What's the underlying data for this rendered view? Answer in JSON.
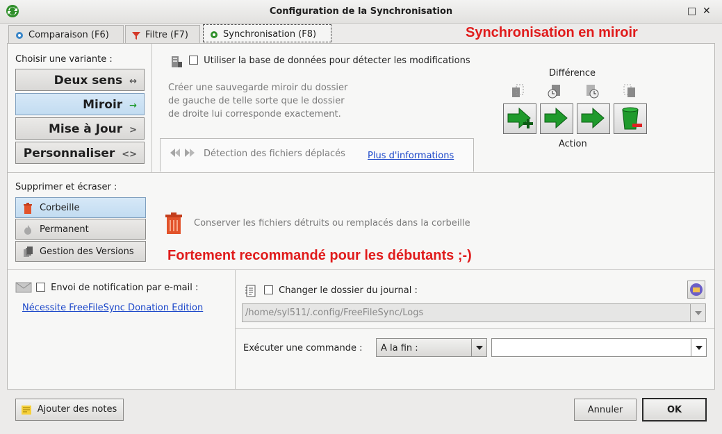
{
  "window": {
    "title": "Configuration de la Synchronisation",
    "maximize_glyph": "□",
    "close_glyph": "✕"
  },
  "tabs": [
    {
      "label": "Comparaison (F6)",
      "icon": "gear-icon"
    },
    {
      "label": "Filtre (F7)",
      "icon": "filter-icon"
    },
    {
      "label": "Synchronisation (F8)",
      "icon": "gear-icon"
    }
  ],
  "annotations": {
    "mirror": "Synchronisation en miroir",
    "recommend": "Fortement recommandé pour les débutants ;-)"
  },
  "variants": {
    "heading": "Choisir une variante :",
    "items": [
      {
        "label": "Deux sens",
        "glyph": "↔"
      },
      {
        "label": "Miroir",
        "glyph": "→"
      },
      {
        "label": "Mise à Jour",
        "glyph": ">"
      },
      {
        "label": "Personnaliser",
        "glyph": "<>"
      }
    ],
    "selected": "Miroir"
  },
  "database": {
    "label": "Utiliser la base de données pour détecter les modifications",
    "checked": false
  },
  "description": "Créer une sauvegarde miroir du dossier de gauche de telle sorte que le dossier de droite lui corresponde exactement.",
  "moved_files": {
    "label": "Détection des fichiers déplacés",
    "link": "Plus d'informations"
  },
  "matrix": {
    "top_label": "Différence",
    "bottom_label": "Action"
  },
  "deletion": {
    "heading": "Supprimer et écraser :",
    "items": [
      {
        "label": "Corbeille"
      },
      {
        "label": "Permanent"
      },
      {
        "label": "Gestion des Versions"
      }
    ],
    "selected": "Corbeille",
    "info": "Conserver les fichiers détruits ou remplacés dans la corbeille"
  },
  "email": {
    "label": "Envoi de notification par e-mail :",
    "checked": false,
    "link": "Nécessite FreeFileSync Donation Edition"
  },
  "log": {
    "label": "Changer le dossier du journal :",
    "checked": false,
    "path": "/home/syl511/.config/FreeFileSync/Logs"
  },
  "command": {
    "label": "Exécuter une commande :",
    "when": "A la fin :",
    "value": ""
  },
  "footer": {
    "notes": "Ajouter des notes",
    "cancel": "Annuler",
    "ok": "OK"
  },
  "colors": {
    "accent_red": "#e01b1b",
    "selected_bg": "#c2dcf1",
    "link": "#1a46c9",
    "action_green": "#1f9a2c"
  }
}
